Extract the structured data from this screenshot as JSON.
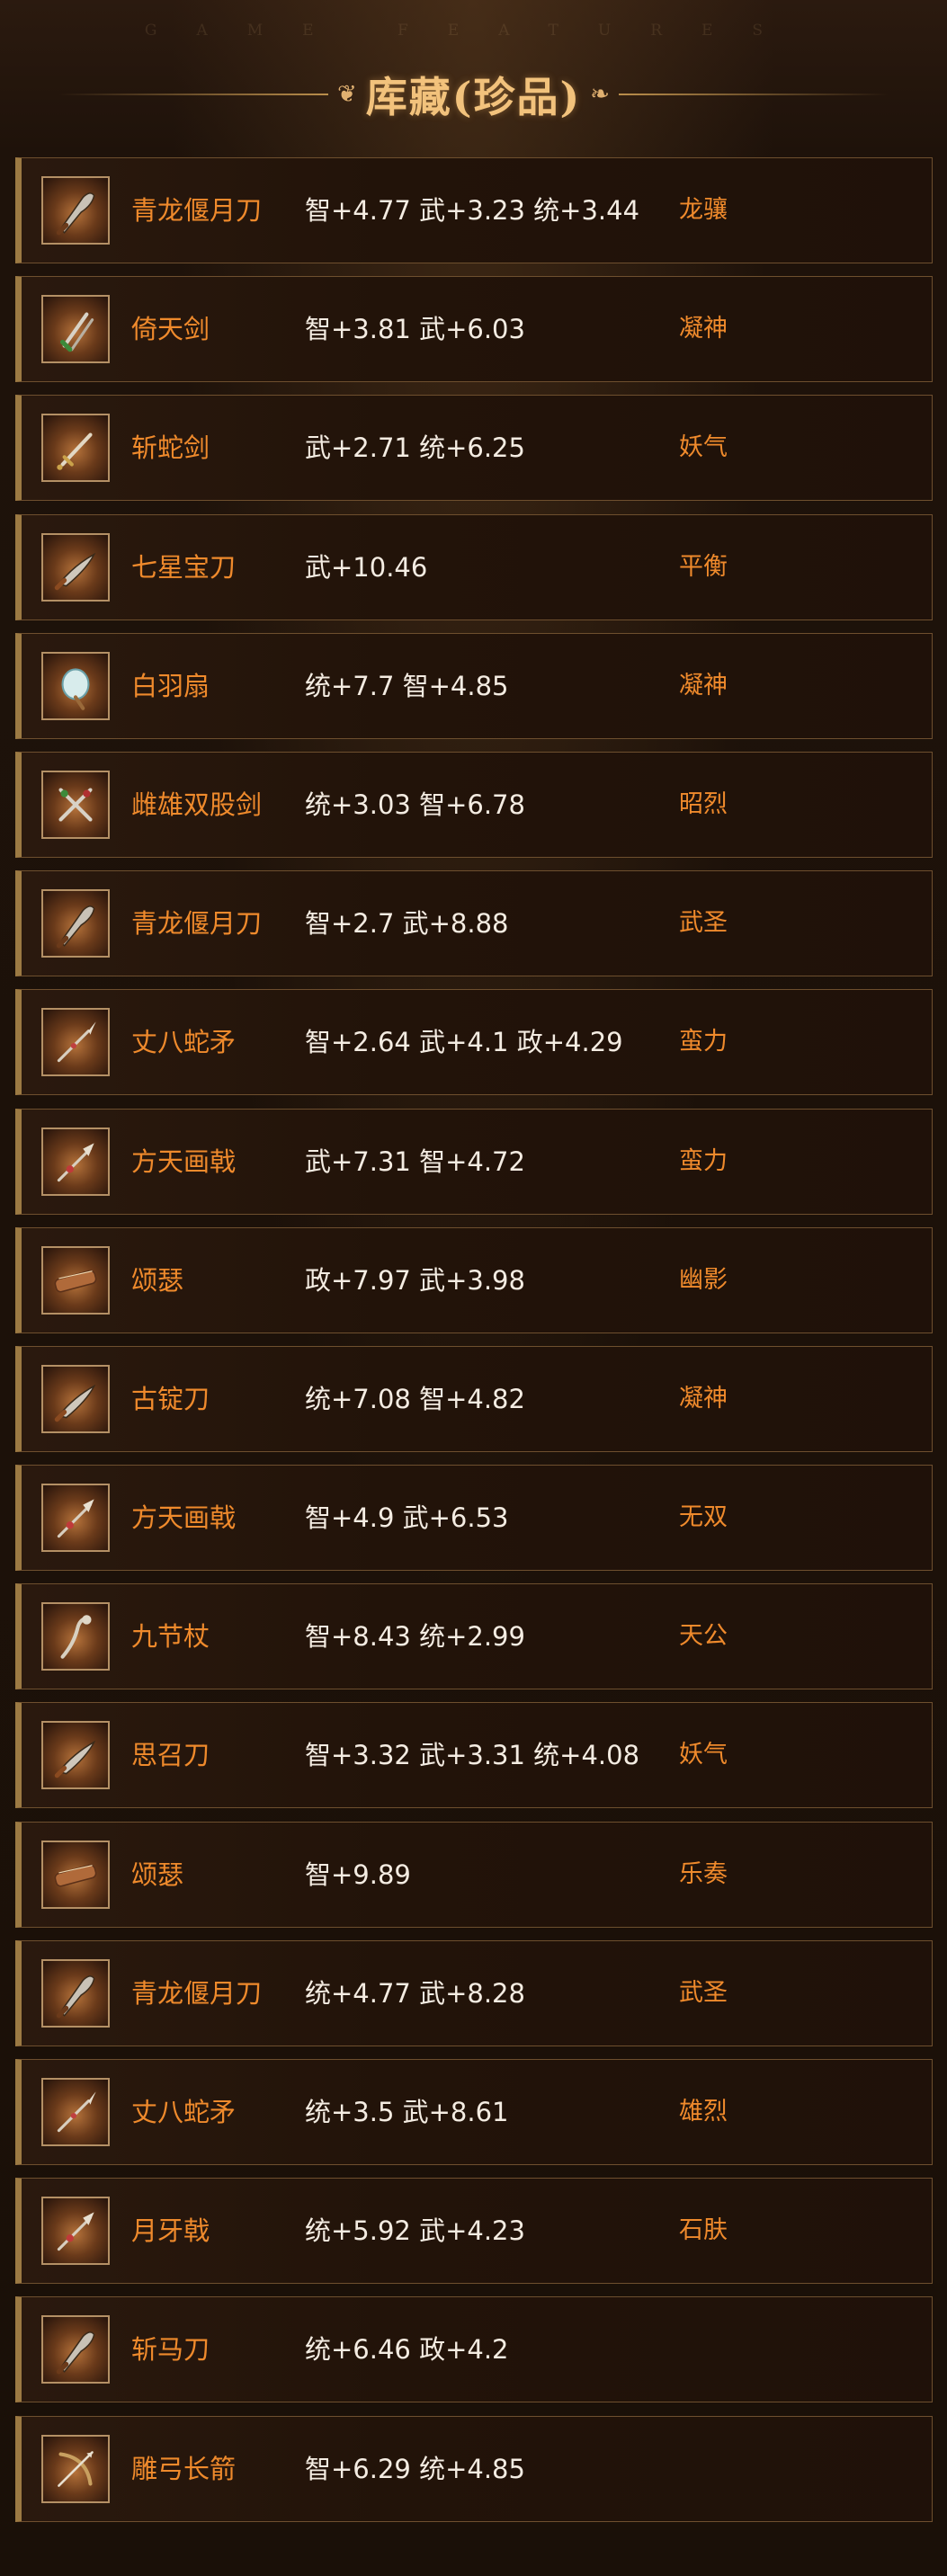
{
  "header": {
    "watermark": "GAME FEATURES",
    "title": "库藏(珍品)"
  },
  "items": [
    {
      "icon": "blade-icon",
      "name": "青龙偃月刀",
      "stats": "智+4.77 武+3.23 统+3.44",
      "trait": "龙骧"
    },
    {
      "icon": "twin-sword-icon",
      "name": "倚天剑",
      "stats": "智+3.81 武+6.03",
      "trait": "凝神"
    },
    {
      "icon": "sword-icon",
      "name": "斩蛇剑",
      "stats": "武+2.71 统+6.25",
      "trait": "妖气"
    },
    {
      "icon": "saber-icon",
      "name": "七星宝刀",
      "stats": "武+10.46",
      "trait": "平衡"
    },
    {
      "icon": "feather-fan-icon",
      "name": "白羽扇",
      "stats": "统+7.7 智+4.85",
      "trait": "凝神"
    },
    {
      "icon": "crossed-swords-icon",
      "name": "雌雄双股剑",
      "stats": "统+3.03 智+6.78",
      "trait": "昭烈"
    },
    {
      "icon": "blade-icon",
      "name": "青龙偃月刀",
      "stats": "智+2.7 武+8.88",
      "trait": "武圣"
    },
    {
      "icon": "spear-icon",
      "name": "丈八蛇矛",
      "stats": "智+2.64 武+4.1 政+4.29",
      "trait": "蛮力"
    },
    {
      "icon": "halberd-icon",
      "name": "方天画戟",
      "stats": "武+7.31 智+4.72",
      "trait": "蛮力"
    },
    {
      "icon": "zither-icon",
      "name": "颂瑟",
      "stats": "政+7.97 武+3.98",
      "trait": "幽影"
    },
    {
      "icon": "saber-icon",
      "name": "古锭刀",
      "stats": "统+7.08 智+4.82",
      "trait": "凝神"
    },
    {
      "icon": "halberd-icon",
      "name": "方天画戟",
      "stats": "智+4.9 武+6.53",
      "trait": "无双"
    },
    {
      "icon": "staff-icon",
      "name": "九节杖",
      "stats": "智+8.43 统+2.99",
      "trait": "天公"
    },
    {
      "icon": "saber-icon",
      "name": "思召刀",
      "stats": "智+3.32 武+3.31 统+4.08",
      "trait": "妖气"
    },
    {
      "icon": "zither-icon",
      "name": "颂瑟",
      "stats": "智+9.89",
      "trait": "乐奏"
    },
    {
      "icon": "blade-icon",
      "name": "青龙偃月刀",
      "stats": "统+4.77 武+8.28",
      "trait": "武圣"
    },
    {
      "icon": "spear-icon",
      "name": "丈八蛇矛",
      "stats": "统+3.5 武+8.61",
      "trait": "雄烈"
    },
    {
      "icon": "halberd-icon",
      "name": "月牙戟",
      "stats": "统+5.92 武+4.23",
      "trait": "石肤"
    },
    {
      "icon": "blade-icon",
      "name": "斩马刀",
      "stats": "统+6.46 政+4.2",
      "trait": ""
    },
    {
      "icon": "bow-arrow-icon",
      "name": "雕弓长箭",
      "stats": "智+6.29 统+4.85",
      "trait": ""
    }
  ]
}
